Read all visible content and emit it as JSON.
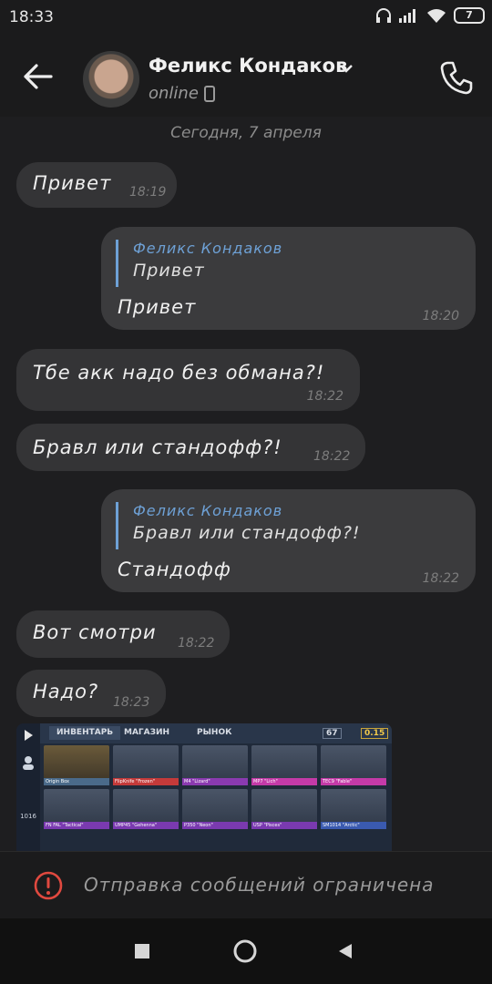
{
  "status_bar": {
    "time": "18:33",
    "battery": "7"
  },
  "header": {
    "contact_name": "Феликс Кондаков",
    "status": "online"
  },
  "chat": {
    "date_separator": "Сегодня, 7 апреля",
    "messages": [
      {
        "dir": "in",
        "text": "Привет",
        "time": "18:19"
      },
      {
        "dir": "out",
        "reply_name": "Феликс Кондаков",
        "reply_text": "Привет",
        "text": "Привет",
        "time": "18:20"
      },
      {
        "dir": "in",
        "text": "Тбе акк надо без обмана?!",
        "time": "18:22"
      },
      {
        "dir": "in",
        "text": "Бравл или стандофф?!",
        "time": "18:22"
      },
      {
        "dir": "out",
        "reply_name": "Феликс Кондаков",
        "reply_text": "Бравл или стандофф?!",
        "text": "Стандофф",
        "time": "18:22"
      },
      {
        "dir": "in",
        "text": "Вот смотри",
        "time": "18:22"
      },
      {
        "dir": "in",
        "text": "Надо?",
        "time": "18:23"
      }
    ],
    "image": {
      "tabs": [
        "ИНВЕНТАРЬ",
        "МАГАЗИН",
        "РЫНОК"
      ],
      "currency_1": "67",
      "currency_2": "0.15",
      "side_count": "1016",
      "items": [
        "Origin Box",
        "FlipKnife \"Frozen\"",
        "M4 \"Lizard\"",
        "MP7 \"Lich\"",
        "TEC9 \"Fable\"",
        "FN FAL \"Tactical\"",
        "UMP45 \"Gehenna\"",
        "P350 \"Neon\"",
        "USP \"Pisces\"",
        "SM1014 \"Arctic\""
      ]
    }
  },
  "restriction": {
    "text": "Отправка сообщений ограничена"
  },
  "colors": {
    "accent": "#6ea1d6",
    "bubble_in": "#343436",
    "bubble_out": "#3b3b3d",
    "background": "#1e1e20"
  }
}
